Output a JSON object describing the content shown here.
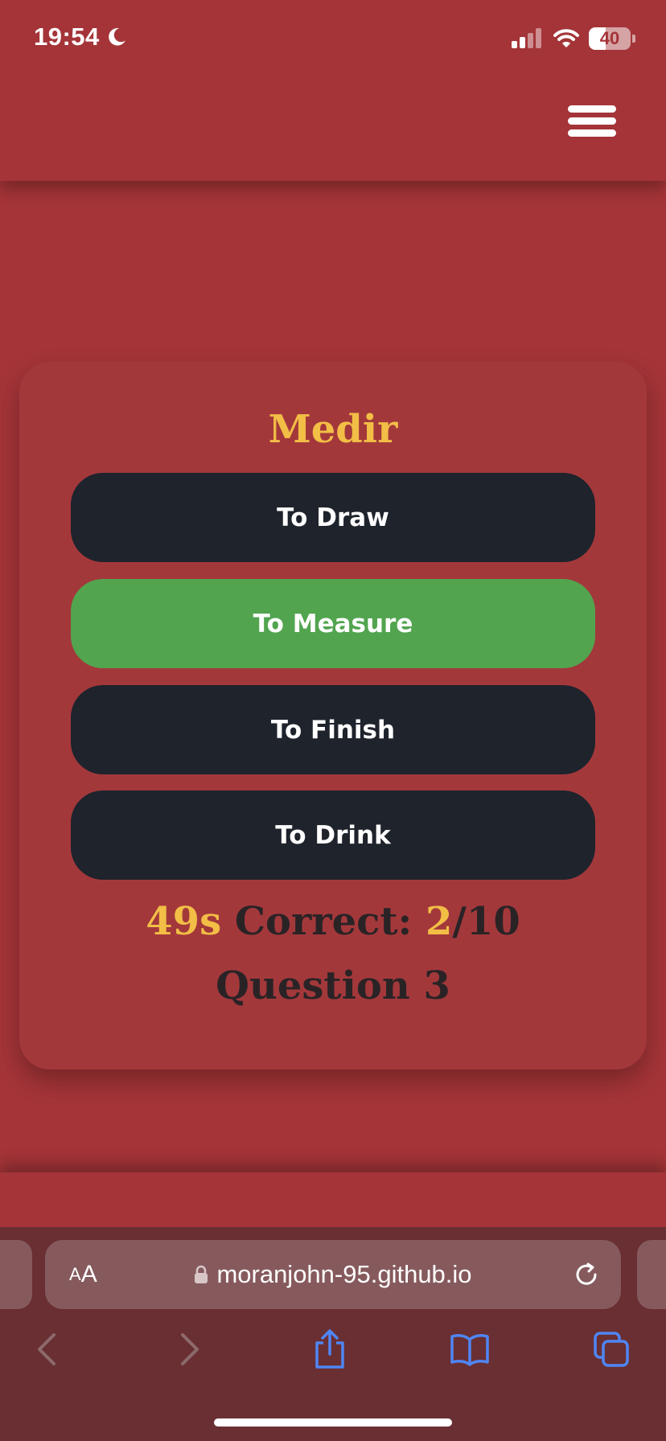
{
  "status_bar": {
    "time": "19:54",
    "battery_level": "40",
    "icons": [
      "moon-icon",
      "signal-icon",
      "wifi-icon",
      "battery-icon"
    ]
  },
  "header": {
    "menu_icon": "hamburger-menu-icon"
  },
  "quiz": {
    "word": "Medir",
    "answers": [
      {
        "label": "To Draw",
        "state": "default"
      },
      {
        "label": "To Measure",
        "state": "correct"
      },
      {
        "label": "To Finish",
        "state": "default"
      },
      {
        "label": "To Drink",
        "state": "default"
      }
    ],
    "timer": "49s",
    "correct_label": "Correct: ",
    "correct_count": "2",
    "total": "/10",
    "question_label": "Question 3"
  },
  "browser": {
    "aa_small": "A",
    "aa_big": "A",
    "url": "moranjohn-95.github.io",
    "toolbar_icons": [
      "back-icon",
      "forward-icon",
      "share-icon",
      "bookmarks-icon",
      "tabs-icon"
    ]
  },
  "colors": {
    "background": "#a43438",
    "accent_gold": "#f2be46",
    "button_dark": "#1e232c",
    "button_correct": "#52a44f",
    "text_dark": "#2a2326",
    "browser_chrome": "#692f33"
  }
}
